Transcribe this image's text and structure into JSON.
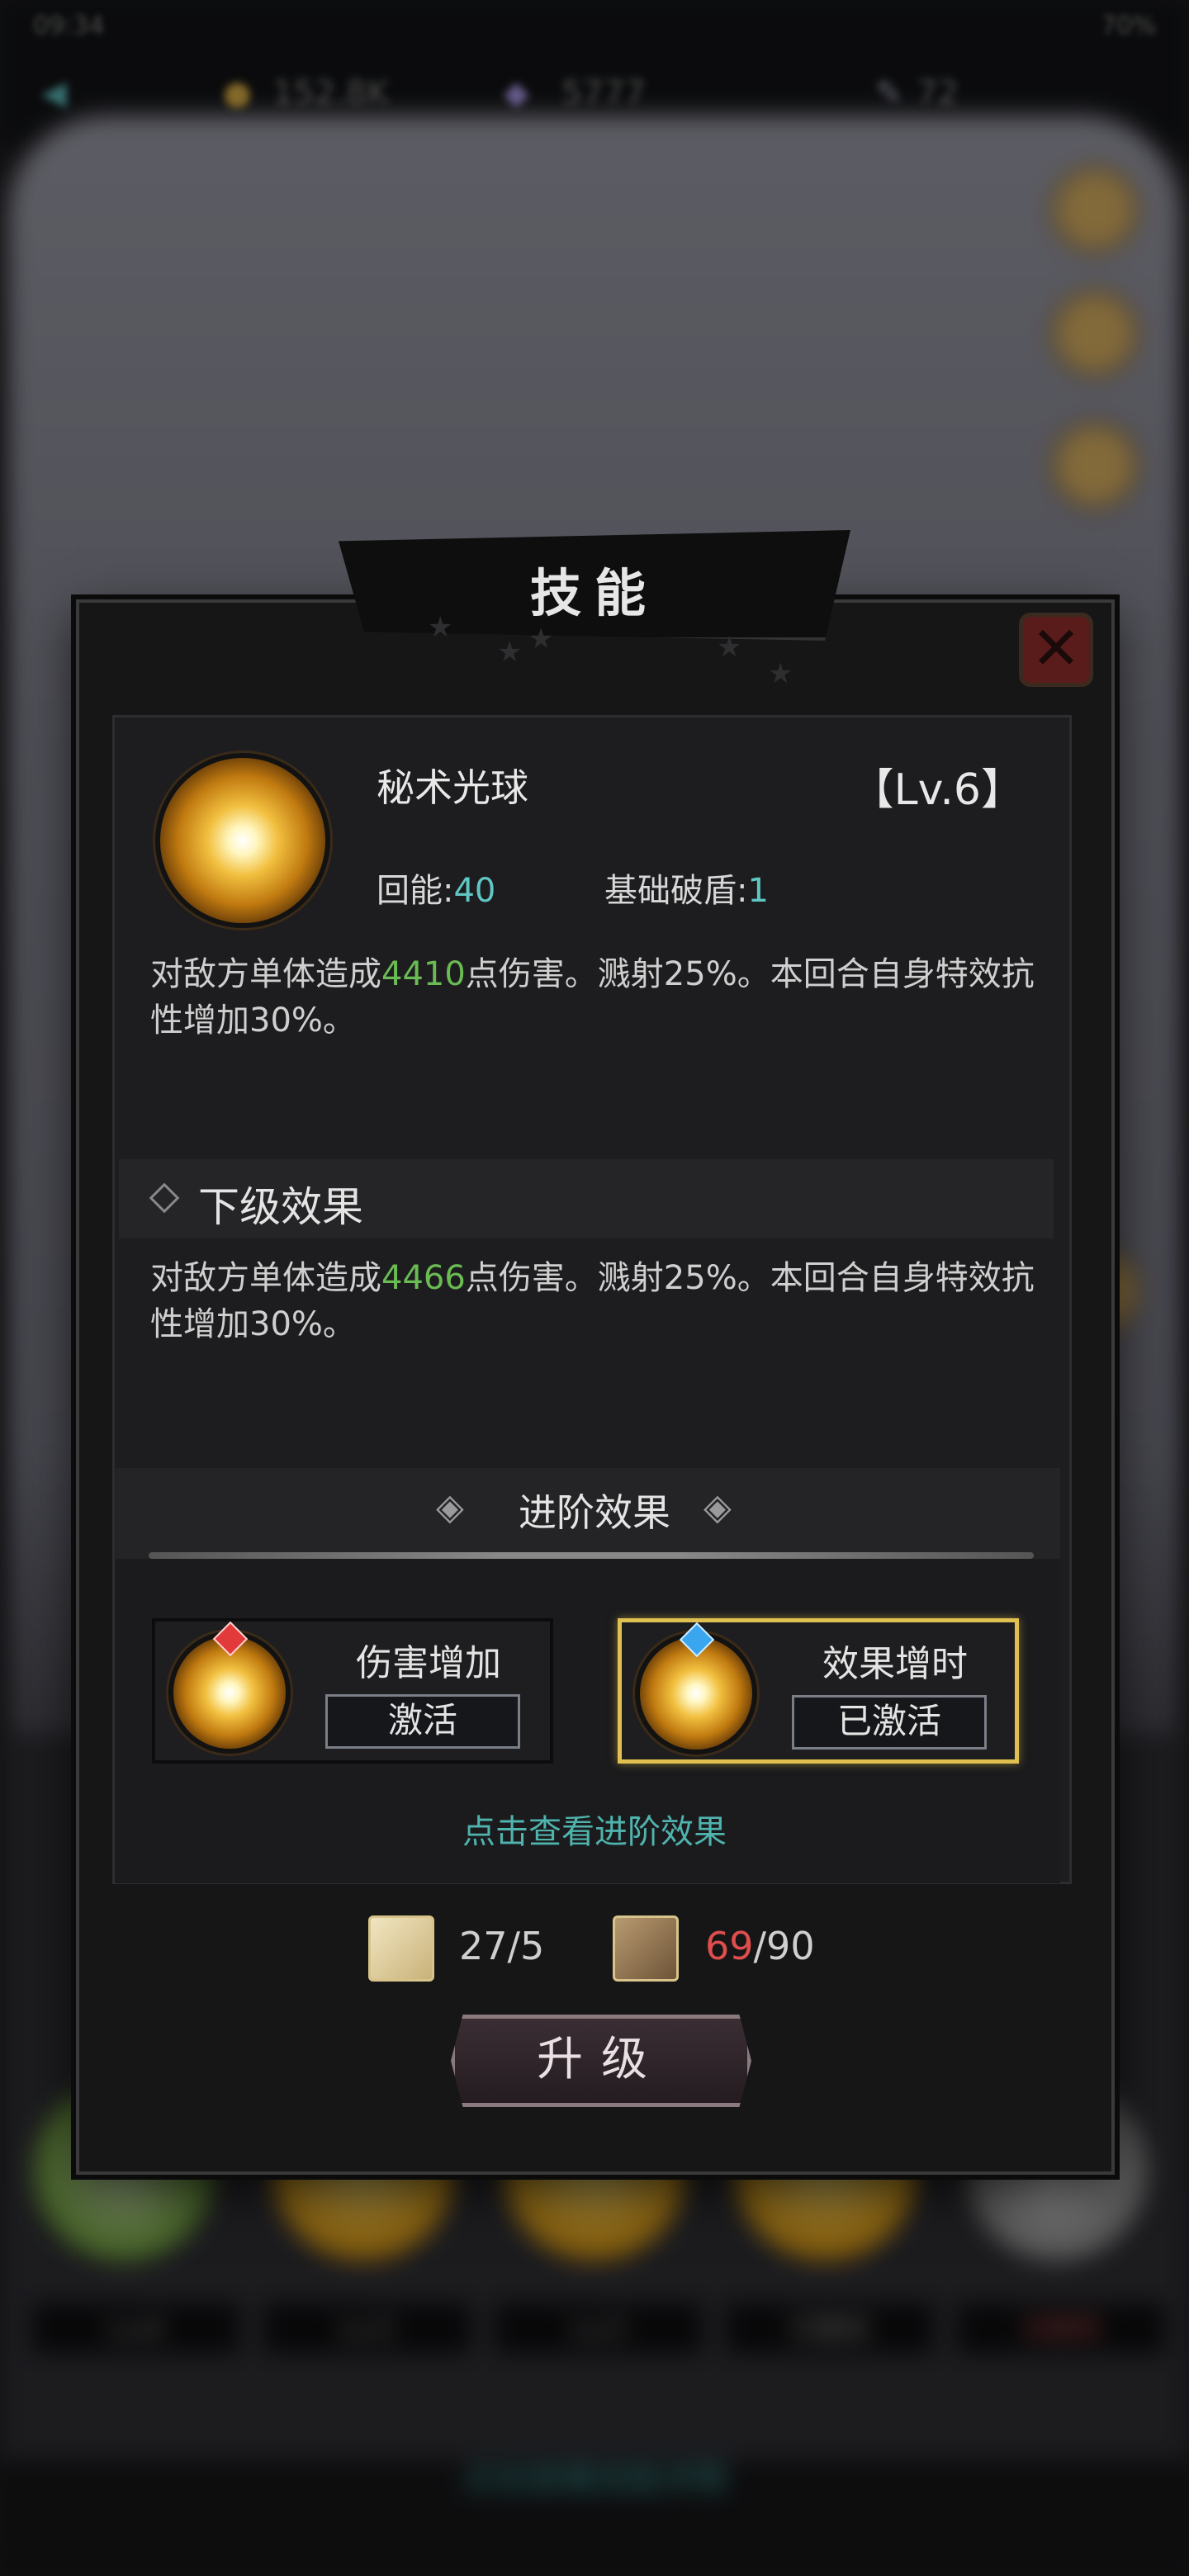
{
  "status_bar": {
    "time": "09:34",
    "battery": "70%"
  },
  "resources": {
    "gold": "152.8K",
    "gems": "5777",
    "energy": "72"
  },
  "background_levels": [
    "Lv.6",
    "Lv.5",
    "Lv.5",
    "已激活",
    "未解锁"
  ],
  "background_link": "点击查看技能详情",
  "dialog": {
    "title": "技能",
    "skill": {
      "name": "秘术光球",
      "level": "【Lv.6】",
      "energy_label": "回能:",
      "energy_value": "40",
      "break_label": "基础破盾:",
      "break_value": "1",
      "desc_pre": "对敌方单体造成",
      "desc_value": "4410",
      "desc_post": "点伤害。溅射25%。本回合自身特效抗性增加30%。"
    },
    "next_level": {
      "title": "下级效果",
      "desc_pre": "对敌方单体造成",
      "desc_value": "4466",
      "desc_post": "点伤害。溅射25%。本回合自身特效抗性增加30%。"
    },
    "advanced": {
      "title": "进阶效果",
      "options": [
        {
          "name": "伤害增加",
          "button": "激活",
          "gem": "red"
        },
        {
          "name": "效果增时",
          "button": "已激活",
          "gem": "blue"
        }
      ],
      "view_link": "点击查看进阶效果"
    },
    "materials": {
      "book_have": "27",
      "book_need": "5",
      "scroll_have": "69",
      "scroll_need": "90"
    },
    "upgrade_button": "升级"
  },
  "colors": {
    "highlight_green": "#6abb53",
    "stat_teal": "#5fc7c4",
    "selected_gold": "#e0c050",
    "insufficient_red": "#e04d4d"
  }
}
